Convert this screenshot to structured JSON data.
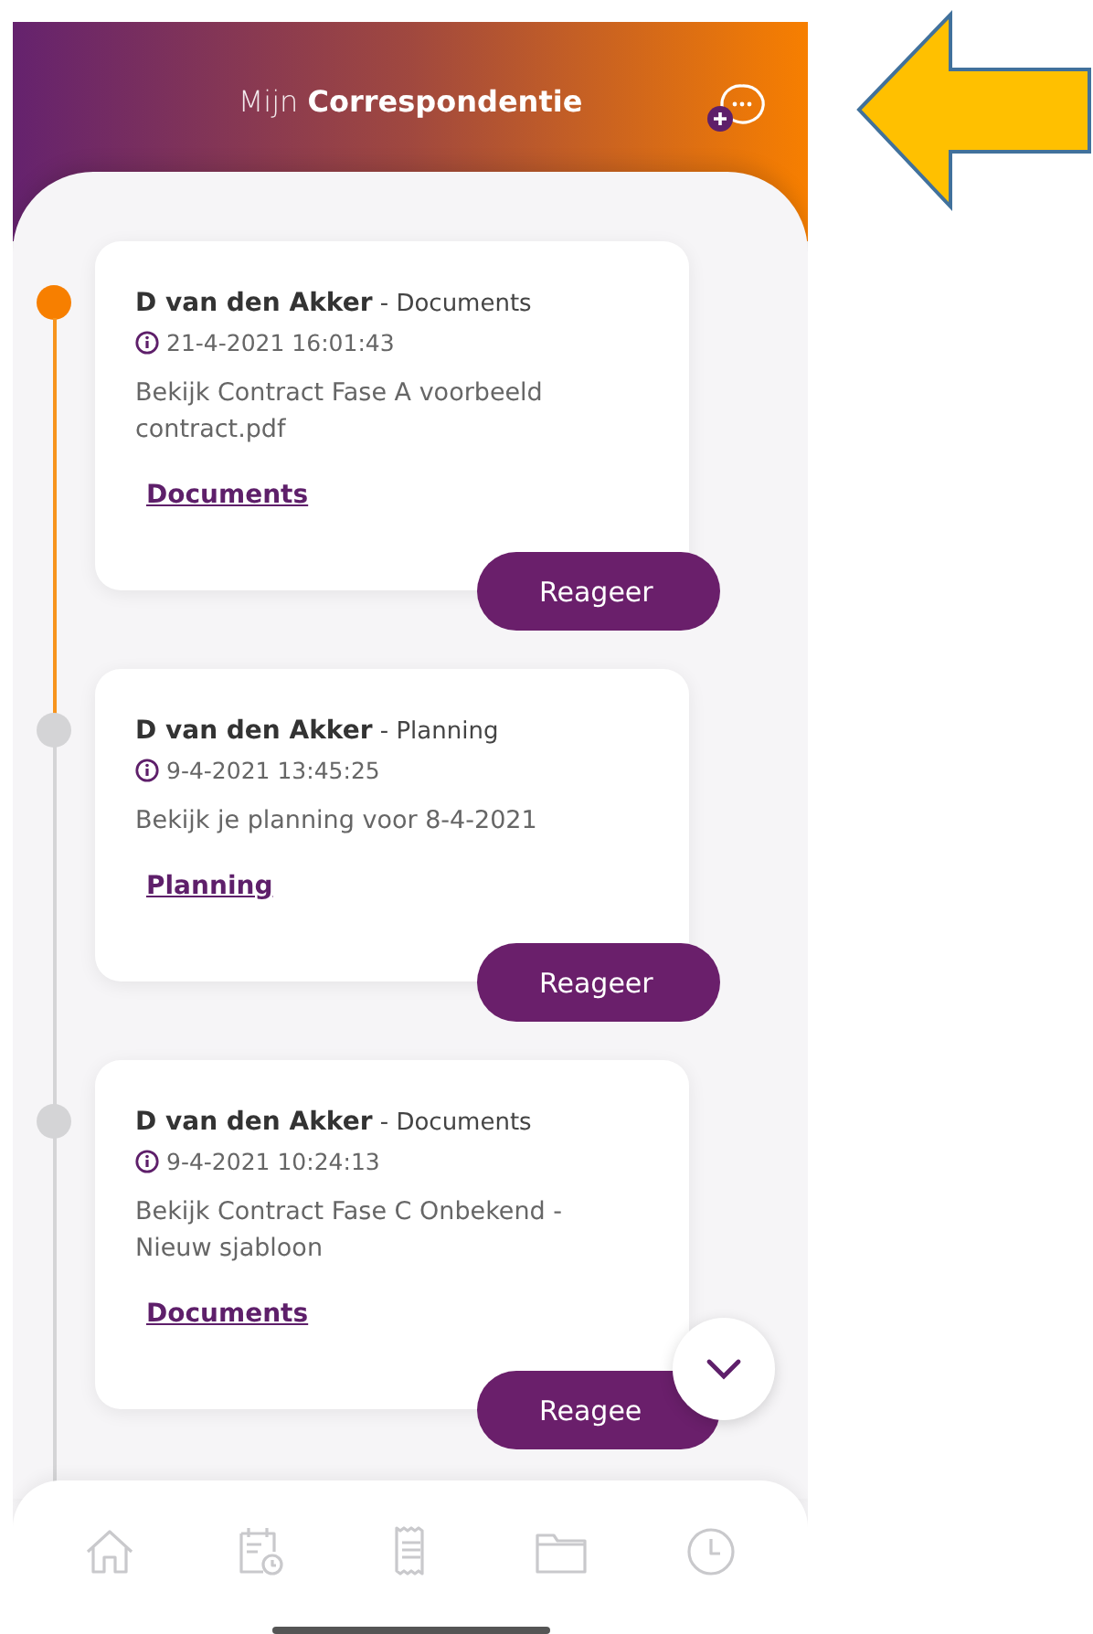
{
  "header": {
    "title_light": "Mijn",
    "title_bold": "Correspondentie"
  },
  "messages": [
    {
      "author": "D van den Akker",
      "category": "- Documents",
      "timestamp": "21-4-2021 16:01:43",
      "text": "Bekijk Contract Fase A voorbeeld contract.pdf",
      "link": "Documents",
      "button": "Reageer",
      "active": true
    },
    {
      "author": "D van den Akker",
      "category": "- Planning",
      "timestamp": "9-4-2021 13:45:25",
      "text": "Bekijk je planning voor 8-4-2021",
      "link": "Planning",
      "button": "Reageer",
      "active": false
    },
    {
      "author": "D van den Akker",
      "category": "- Documents",
      "timestamp": "9-4-2021 10:24:13",
      "text": "Bekijk Contract Fase C Onbekend - Nieuw sjabloon",
      "link": "Documents",
      "button": "Reagee",
      "active": false
    }
  ],
  "nav": [
    {
      "kind": "home"
    },
    {
      "kind": "calendar"
    },
    {
      "kind": "receipt"
    },
    {
      "kind": "folder"
    },
    {
      "kind": "clock"
    }
  ]
}
